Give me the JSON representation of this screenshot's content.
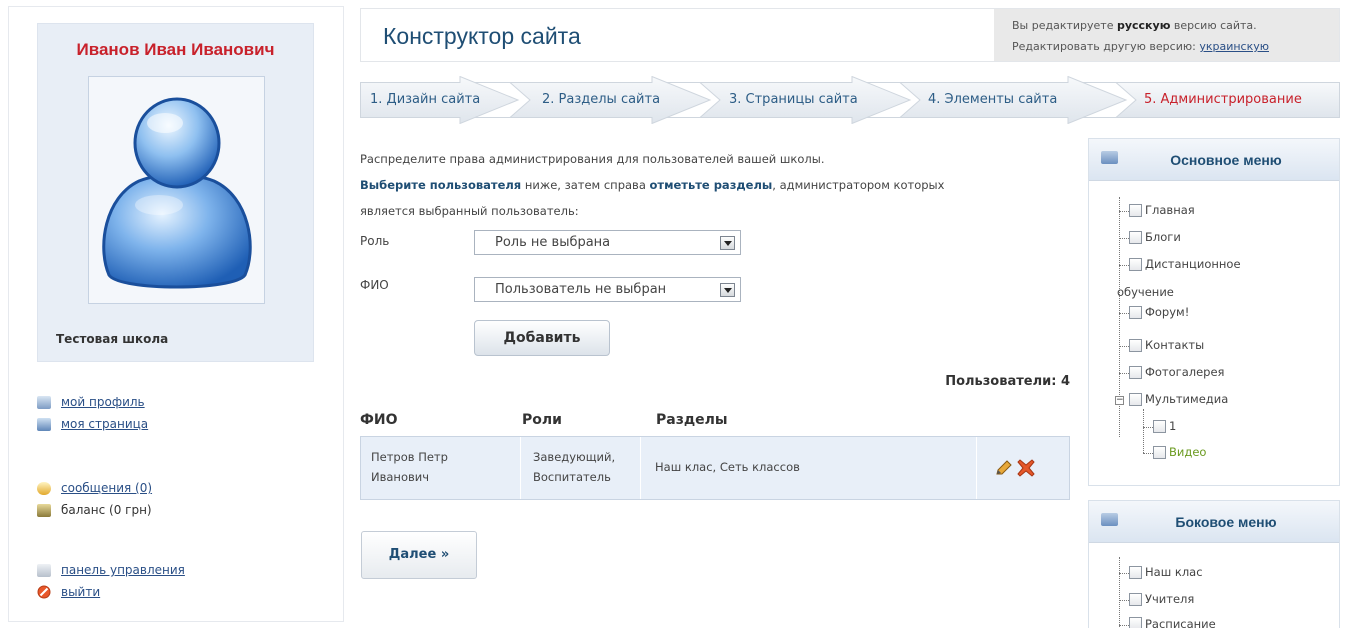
{
  "profile": {
    "name": "Иванов Иван Иванович",
    "school": "Тестовая школа"
  },
  "user_menu": {
    "my_profile": "мой профиль",
    "my_page": "моя страница",
    "messages": "сообщения (0)",
    "balance": "баланс (0 грн)",
    "control_panel": "панель управления",
    "logout": "выйти"
  },
  "header": {
    "title": "Конструктор сайта",
    "lang_prefix": "Вы редактируете ",
    "lang_current": "русскую",
    "lang_suffix": " версию сайта.",
    "lang_other_prefix": "Редактировать другую версию: ",
    "lang_other_link": "украинскую"
  },
  "steps": [
    {
      "label": "1. Дизайн сайта",
      "active": false
    },
    {
      "label": "2. Разделы сайта",
      "active": false
    },
    {
      "label": "3. Страницы сайта",
      "active": false
    },
    {
      "label": "4. Элементы сайта",
      "active": false
    },
    {
      "label": "5. Администрирование",
      "active": true
    }
  ],
  "intro": {
    "line1": "Распределите права администрирования для пользователей вашей школы.",
    "bold1": "Выберите пользователя",
    "mid": " ниже, затем справа ",
    "bold2": "отметьте разделы",
    "tail": ", администратором которых",
    "line3": "является выбранный пользователь:"
  },
  "form": {
    "role_label": "Роль",
    "role_value": "Роль не выбрана",
    "fio_label": "ФИО",
    "fio_value": "Пользователь не выбран",
    "add_button": "Добавить"
  },
  "users": {
    "count_label": "Пользователи: 4",
    "headers": {
      "fio": "ФИО",
      "roles": "Роли",
      "sections": "Разделы"
    },
    "rows": [
      {
        "fio_line1": "Петров Петр",
        "fio_line2": "Иванович",
        "roles_line1": "Заведующий,",
        "roles_line2": "Воспитатель",
        "sections": "Наш клас, Сеть классов"
      }
    ]
  },
  "next_button": "Далее »",
  "main_menu": {
    "title": "Основное меню",
    "items": {
      "home": "Главная",
      "blogs": "Блоги",
      "distance_1": "Дистанционное",
      "distance_2": "обучение",
      "forum": "Форум!",
      "contacts": "Контакты",
      "gallery": "Фотогалерея",
      "multimedia": "Мультимедиа",
      "sub_1": "1",
      "video": "Видео"
    }
  },
  "side_menu": {
    "title": "Боковое меню",
    "items": {
      "our_class": "Наш клас",
      "teachers": "Учителя",
      "schedule": "Расписание"
    }
  },
  "colors": {
    "accent_red": "#c8212b",
    "link_blue": "#2a4f86",
    "heading_blue": "#1f4e74",
    "row_bg": "#e8eff8",
    "video_green": "#6a9a1f"
  }
}
